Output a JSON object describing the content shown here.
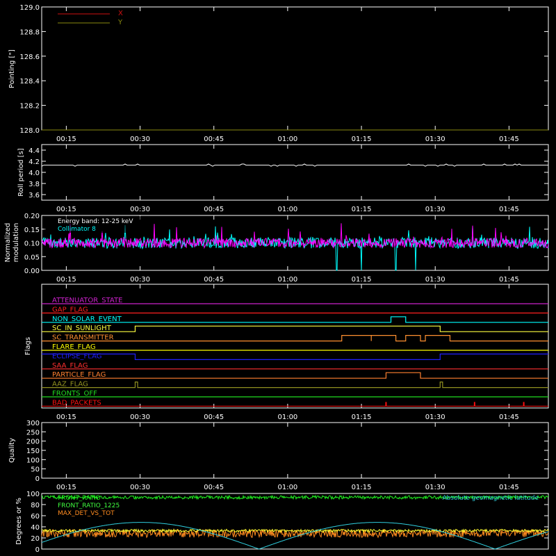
{
  "time_ticks": [
    "00:15",
    "00:30",
    "00:45",
    "01:00",
    "01:15",
    "01:30",
    "01:45"
  ],
  "chart_data": [
    {
      "id": "pointing",
      "type": "line",
      "ylabel": "Pointing [\"]",
      "ylim": [
        128.0,
        129.0
      ],
      "yticks": [
        "129.0",
        "128.8",
        "128.6",
        "128.4",
        "128.2",
        "128.0"
      ],
      "legend_position": "top-left",
      "series": [
        {
          "name": "X",
          "color": "#d01010",
          "values": []
        },
        {
          "name": "Y",
          "color": "#8a8a10",
          "values": []
        }
      ]
    },
    {
      "id": "roll-period",
      "type": "line",
      "ylabel": "Roll period [s]",
      "ylim": [
        3.5,
        4.5
      ],
      "yticks": [
        "4.4",
        "4.2",
        "4.0",
        "3.8",
        "3.6"
      ],
      "series": [
        {
          "color": "#ffffff",
          "typical_value": 4.13
        }
      ]
    },
    {
      "id": "modulation",
      "type": "line",
      "ylabel_lines": [
        "Normalized",
        "modulation"
      ],
      "ylim": [
        0.0,
        0.2
      ],
      "yticks": [
        "0.20",
        "0.15",
        "0.10",
        "0.05",
        "0.00"
      ],
      "annotation": "Energy band: 12-25 keV",
      "series": [
        {
          "name": "Collimator 8",
          "color": "#00ffff",
          "mean": 0.1,
          "dropouts_hhmm": [
            "01:10",
            "01:15",
            "01:22",
            "01:26"
          ]
        },
        {
          "color": "#ff00ff",
          "mean": 0.1
        }
      ]
    },
    {
      "id": "flags",
      "type": "line",
      "ylabel": "Flags",
      "flags": [
        {
          "name": "ATTENUATOR_STATE",
          "color": "#cc22cc",
          "high": []
        },
        {
          "name": "GAP_FLAG",
          "color": "#ff2020",
          "high": []
        },
        {
          "name": "NON_SOLAR_EVENT",
          "color": "#00ffff",
          "high": [
            [
              "01:21",
              "01:24"
            ]
          ]
        },
        {
          "name": "SC_IN_SUNLIGHT",
          "color": "#ffff40",
          "high": [
            [
              "00:29",
              "01:31"
            ]
          ]
        },
        {
          "name": "SC_TRANSMITTER",
          "color": "#ff9030",
          "high": [
            [
              "01:11",
              "01:17"
            ],
            [
              "01:17",
              "01:22"
            ],
            [
              "01:24",
              "01:27"
            ],
            [
              "01:28",
              "01:33"
            ]
          ]
        },
        {
          "name": "FLARE_FLAG",
          "color": "#ffff00",
          "high": []
        },
        {
          "name": "ECLIPSE_FLAG",
          "color": "#2020ff",
          "high": [
            [
              "00:10",
              "00:29"
            ],
            [
              "01:31",
              "01:53"
            ]
          ]
        },
        {
          "name": "SAA_FLAG",
          "color": "#ff3030",
          "high": []
        },
        {
          "name": "PARTICLE_FLAG",
          "color": "#ff8030",
          "high": [
            [
              "01:20",
              "01:27"
            ]
          ]
        },
        {
          "name": "AAZ_FLAG",
          "color": "#909020",
          "high": [
            [
              "00:29",
              "00:29.5"
            ],
            [
              "01:31",
              "01:31.5"
            ]
          ]
        },
        {
          "name": "FRONTS_OFF",
          "color": "#20dd20",
          "high": []
        },
        {
          "name": "BAD_PACKETS",
          "color": "#ff1010",
          "spikes_hhmm": [
            "01:20",
            "01:38",
            "01:48"
          ]
        }
      ]
    },
    {
      "id": "quality",
      "type": "line",
      "ylabel": "Quality",
      "ylim": [
        0,
        300
      ],
      "yticks": [
        "300",
        "250",
        "200",
        "150",
        "100",
        "50",
        "0"
      ],
      "series": [
        {
          "color": "#ffffff",
          "values": []
        }
      ]
    },
    {
      "id": "degrees",
      "type": "line",
      "ylabel": "Degrees or %",
      "ylim": [
        0,
        100
      ],
      "yticks": [
        "100",
        "80",
        "60",
        "40",
        "20",
        "0"
      ],
      "right_annotation": "Absolute geomagnetic latitude",
      "series": [
        {
          "name": "FRONT_RATIO",
          "color": "#20ee20",
          "mean": 93
        },
        {
          "name": "FRONT_RATIO_1225",
          "color": "#40ff40",
          "mean": 92
        },
        {
          "name": "MAX_DET_VS_TOT",
          "color": "#ff8c20",
          "mean": 28
        },
        {
          "color": "#ffff30",
          "mean": 33
        },
        {
          "name": "Absolute geomagnetic latitude",
          "color": "#30d0e0",
          "min": 0,
          "max": 48
        }
      ]
    }
  ]
}
